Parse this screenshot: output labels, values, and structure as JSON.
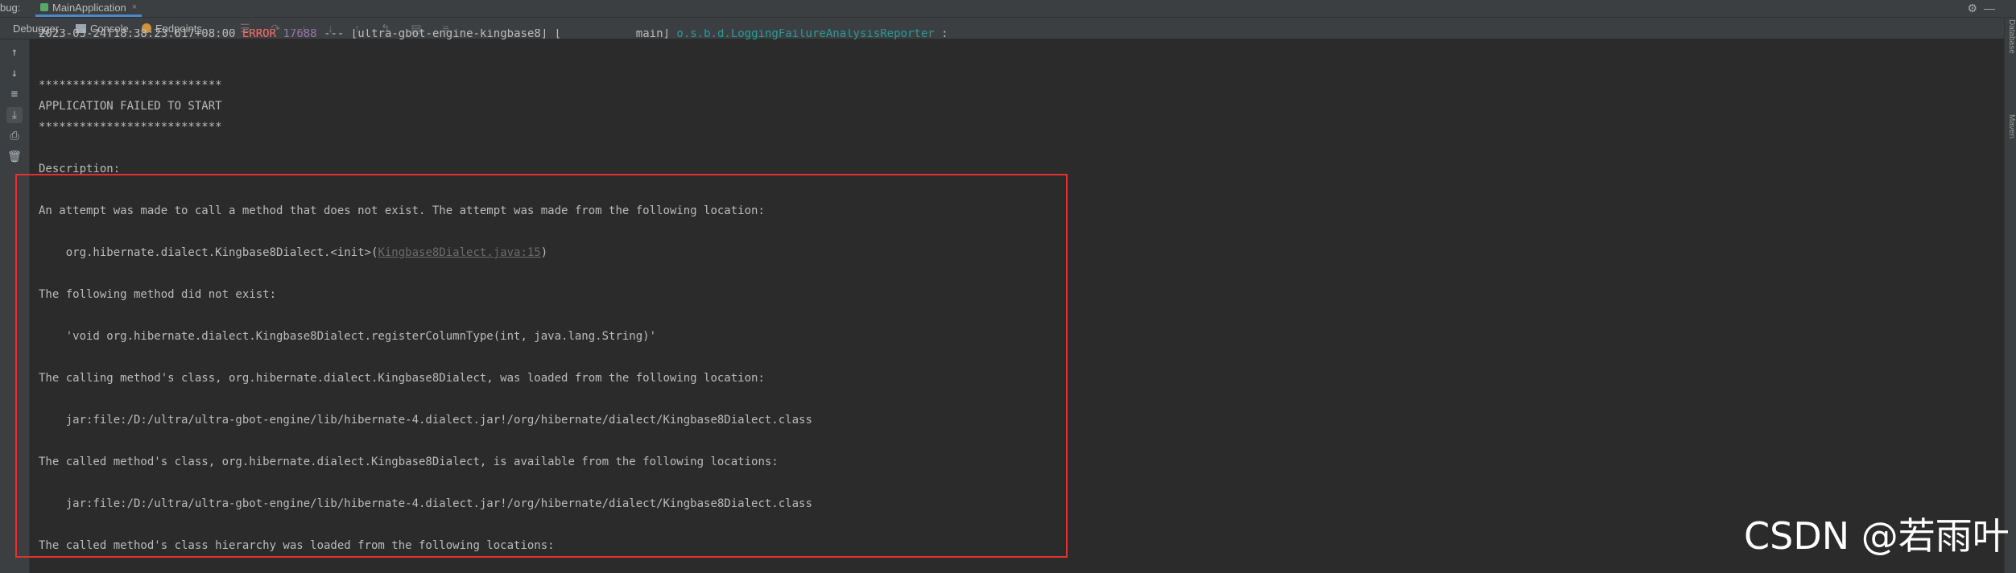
{
  "session_bar": {
    "prefix": "bug:",
    "tab_label": "MainApplication",
    "tab_close": "×"
  },
  "toolbar": {
    "debugger_label": "Debugger",
    "console_label": "Console",
    "endpoints_label": "Endpoints"
  },
  "log_header": {
    "timestamp": "2023-03-24T18:38:23.617+08:00",
    "level": "ERROR",
    "pid": "17688",
    "separator": "---",
    "app": "[ultra-gbot-engine-kingbase8] [           main]",
    "logger": "o.s.b.d.LoggingFailureAnalysisReporter",
    "trailer": ":"
  },
  "lines": {
    "stars_1": "***************************",
    "failed": "APPLICATION FAILED TO START",
    "stars_2": "***************************",
    "description": "Description:",
    "attempt": "An attempt was made to call a method that does not exist. The attempt was made from the following location:",
    "location_prefix": "    org.hibernate.dialect.Kingbase8Dialect.<init>(",
    "location_link": "Kingbase8Dialect.java:15",
    "location_suffix": ")",
    "not_exist": "The following method did not exist:",
    "method": "    'void org.hibernate.dialect.Kingbase8Dialect.registerColumnType(int, java.lang.String)'",
    "calling_class": "The calling method's class, org.hibernate.dialect.Kingbase8Dialect, was loaded from the following location:",
    "jar_1": "    jar:file:/D:/ultra/ultra-gbot-engine/lib/hibernate-4.dialect.jar!/org/hibernate/dialect/Kingbase8Dialect.class",
    "called_class": "The called method's class, org.hibernate.dialect.Kingbase8Dialect, is available from the following locations:",
    "jar_2": "    jar:file:/D:/ultra/ultra-gbot-engine/lib/hibernate-4.dialect.jar!/org/hibernate/dialect/Kingbase8Dialect.class",
    "hierarchy": "The called method's class hierarchy was loaded from the following locations:"
  },
  "watermark": "CSDN @若雨叶",
  "colors": {
    "background": "#2b2b2b",
    "error": "#ff6b68",
    "logger": "#299999",
    "pid": "#9876aa",
    "highlight_box": "#e0322f"
  }
}
